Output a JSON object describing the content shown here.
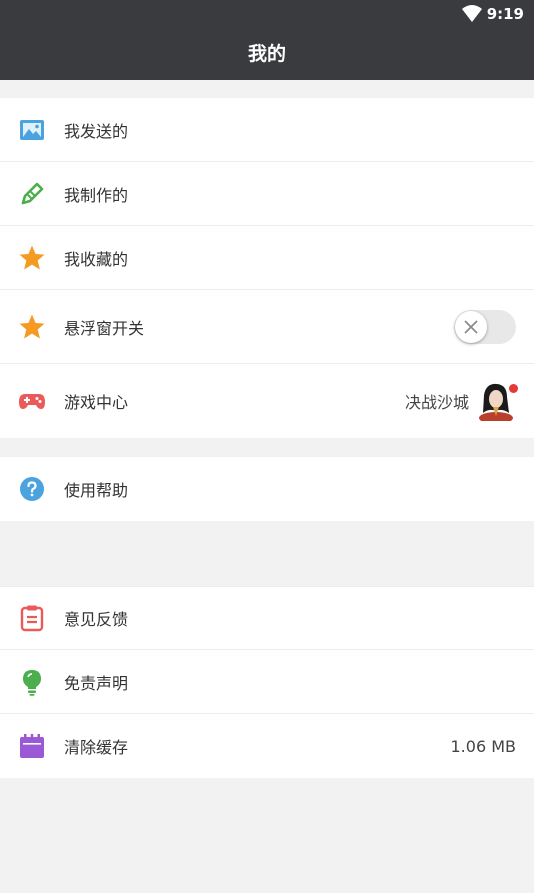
{
  "status": {
    "time": "9:19"
  },
  "header": {
    "title": "我的"
  },
  "group1": [
    {
      "label": "我发送的",
      "icon": "image-icon"
    },
    {
      "label": "我制作的",
      "icon": "pencil-icon"
    },
    {
      "label": "我收藏的",
      "icon": "star-icon"
    },
    {
      "label": "悬浮窗开关",
      "icon": "star-icon",
      "toggle": false
    },
    {
      "label": "游戏中心",
      "icon": "gamepad-icon",
      "value": "决战沙城",
      "badge": true
    }
  ],
  "group2": [
    {
      "label": "使用帮助",
      "icon": "help-icon"
    }
  ],
  "group3": [
    {
      "label": "意见反馈",
      "icon": "clipboard-icon"
    },
    {
      "label": "免责声明",
      "icon": "bulb-icon"
    },
    {
      "label": "清除缓存",
      "icon": "calendar-icon",
      "value": "1.06 MB"
    }
  ],
  "colors": {
    "header_bg": "#3a3b3f",
    "image_icon": "#4aa3df",
    "pencil_icon": "#4cae4c",
    "star_icon": "#f59a23",
    "gamepad_icon": "#ea5a5a",
    "help_icon": "#4aa3df",
    "clipboard_icon": "#ea5a5a",
    "bulb_icon": "#4cae4c",
    "calendar_icon": "#9b59d6"
  }
}
